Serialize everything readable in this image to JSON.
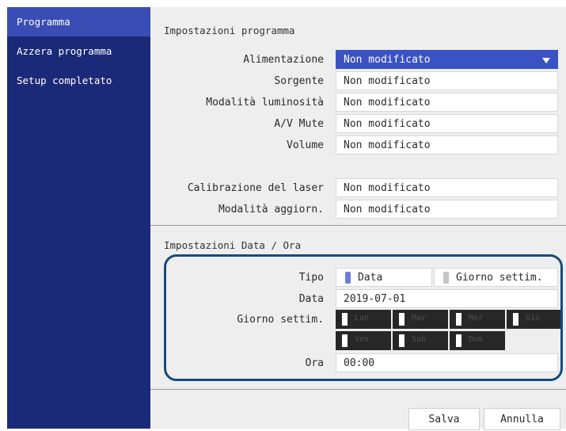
{
  "sidebar": {
    "items": [
      {
        "label": "Programma"
      },
      {
        "label": "Azzera programma"
      },
      {
        "label": "Setup completato"
      }
    ]
  },
  "program_settings": {
    "title": "Impostazioni programma",
    "rows": [
      {
        "label": "Alimentazione",
        "value": "Non modificato"
      },
      {
        "label": "Sorgente",
        "value": "Non modificato"
      },
      {
        "label": "Modalità luminosità",
        "value": "Non modificato"
      },
      {
        "label": "A/V Mute",
        "value": "Non modificato"
      },
      {
        "label": "Volume",
        "value": "Non modificato"
      },
      {
        "label": "Calibrazione del laser",
        "value": "Non modificato"
      },
      {
        "label": "Modalità aggiorn.",
        "value": "Non modificato"
      }
    ]
  },
  "datetime": {
    "title": "Impostazioni Data / Ora",
    "tipo_label": "Tipo",
    "tipo_options": [
      "Data",
      "Giorno settim."
    ],
    "data_label": "Data",
    "data_value": "2019-07-01",
    "weekday_label": "Giorno settim.",
    "weekdays": [
      "Lun",
      "Mar",
      "Mer",
      "Gio",
      "Ven",
      "Sab",
      "Dom"
    ],
    "ora_label": "Ora",
    "ora_value": "00:00"
  },
  "buttons": {
    "save": "Salva",
    "cancel": "Annulla"
  },
  "colors": {
    "sidebar_bg": "#1b2a78",
    "sidebar_active": "#3a4db4",
    "selected_field": "#3b52c4",
    "highlight_border": "#174a7c"
  }
}
